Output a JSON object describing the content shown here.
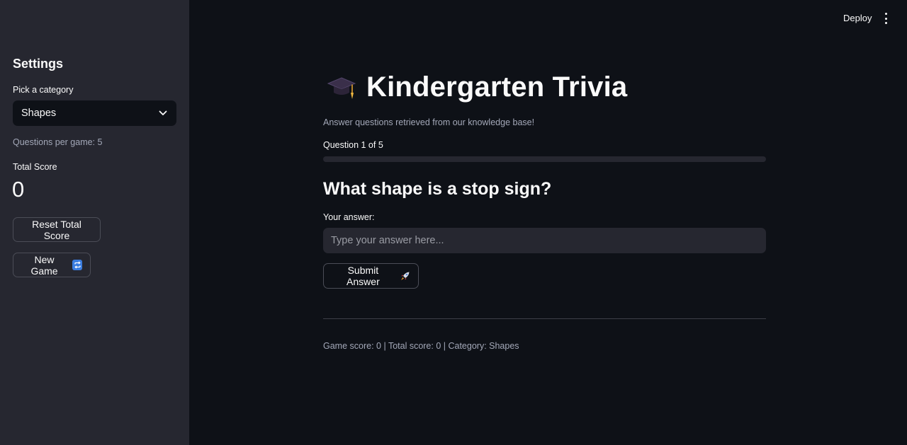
{
  "header": {
    "deploy_label": "Deploy",
    "menu_icon": "kebab-menu-icon"
  },
  "sidebar": {
    "title": "Settings",
    "category_label": "Pick a category",
    "category_value": "Shapes",
    "questions_per_game": "Questions per game: 5",
    "total_score_label": "Total Score",
    "total_score_value": "0",
    "reset_button_label": "Reset Total Score",
    "new_game_button_label": "New Game",
    "new_game_icon": "repeat-icon"
  },
  "main": {
    "title_icon": "graduation-cap-icon",
    "title": "Kindergarten Trivia",
    "subtitle": "Answer questions retrieved from our knowledge base!",
    "progress_text": "Question 1 of 5",
    "progress_fraction": 0.0,
    "question": "What shape is a stop sign?",
    "answer_label": "Your answer:",
    "answer_value": "",
    "answer_placeholder": "Type your answer here...",
    "submit_label": "Submit Answer",
    "submit_icon": "rocket-icon",
    "footer_status": "Game score: 0 | Total score: 0 | Category: Shapes"
  },
  "colors": {
    "background": "#0e1117",
    "sidebar": "#262730",
    "text": "#fafafa",
    "muted_text": "#a3a8b8",
    "accent": "#ff4b4b"
  }
}
